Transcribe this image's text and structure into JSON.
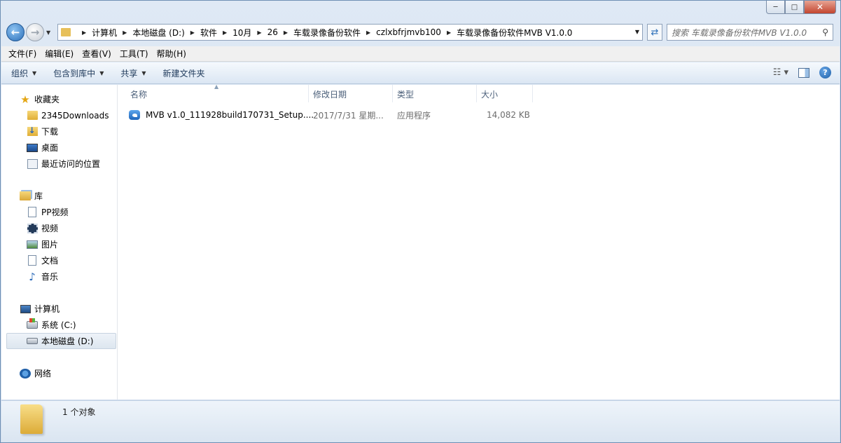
{
  "window": {
    "caption": {
      "minimize": "─",
      "maximize": "□",
      "close": "✕"
    }
  },
  "nav": {
    "back_icon": "arrow-left-icon",
    "forward_icon": "arrow-right-icon",
    "breadcrumbs": [
      "计算机",
      "本地磁盘 (D:)",
      "软件",
      "10月",
      "26",
      "车载录像备份软件",
      "czlxbfrjmvb100",
      "车载录像备份软件MVB V1.0.0"
    ],
    "search_placeholder": "搜索 车载录像备份软件MVB V1.0.0"
  },
  "menubar": {
    "items": [
      "文件(F)",
      "编辑(E)",
      "查看(V)",
      "工具(T)",
      "帮助(H)"
    ]
  },
  "cmdbar": {
    "organize": "组织",
    "include_library": "包含到库中",
    "share": "共享",
    "new_folder": "新建文件夹"
  },
  "sidebar": {
    "favorites": {
      "label": "收藏夹",
      "items": [
        "2345Downloads",
        "下载",
        "桌面",
        "最近访问的位置"
      ]
    },
    "libraries": {
      "label": "库",
      "items": [
        "PP视频",
        "视频",
        "图片",
        "文档",
        "音乐"
      ]
    },
    "computer": {
      "label": "计算机",
      "items": [
        "系统 (C:)",
        "本地磁盘 (D:)"
      ]
    },
    "network": {
      "label": "网络"
    }
  },
  "columns": {
    "name": "名称",
    "modified": "修改日期",
    "type": "类型",
    "size": "大小"
  },
  "files": [
    {
      "name": "MVB v1.0_111928build170731_Setup....",
      "modified": "2017/7/31 星期...",
      "type": "应用程序",
      "size": "14,082 KB"
    }
  ],
  "status": {
    "count_text": "1 个对象"
  }
}
